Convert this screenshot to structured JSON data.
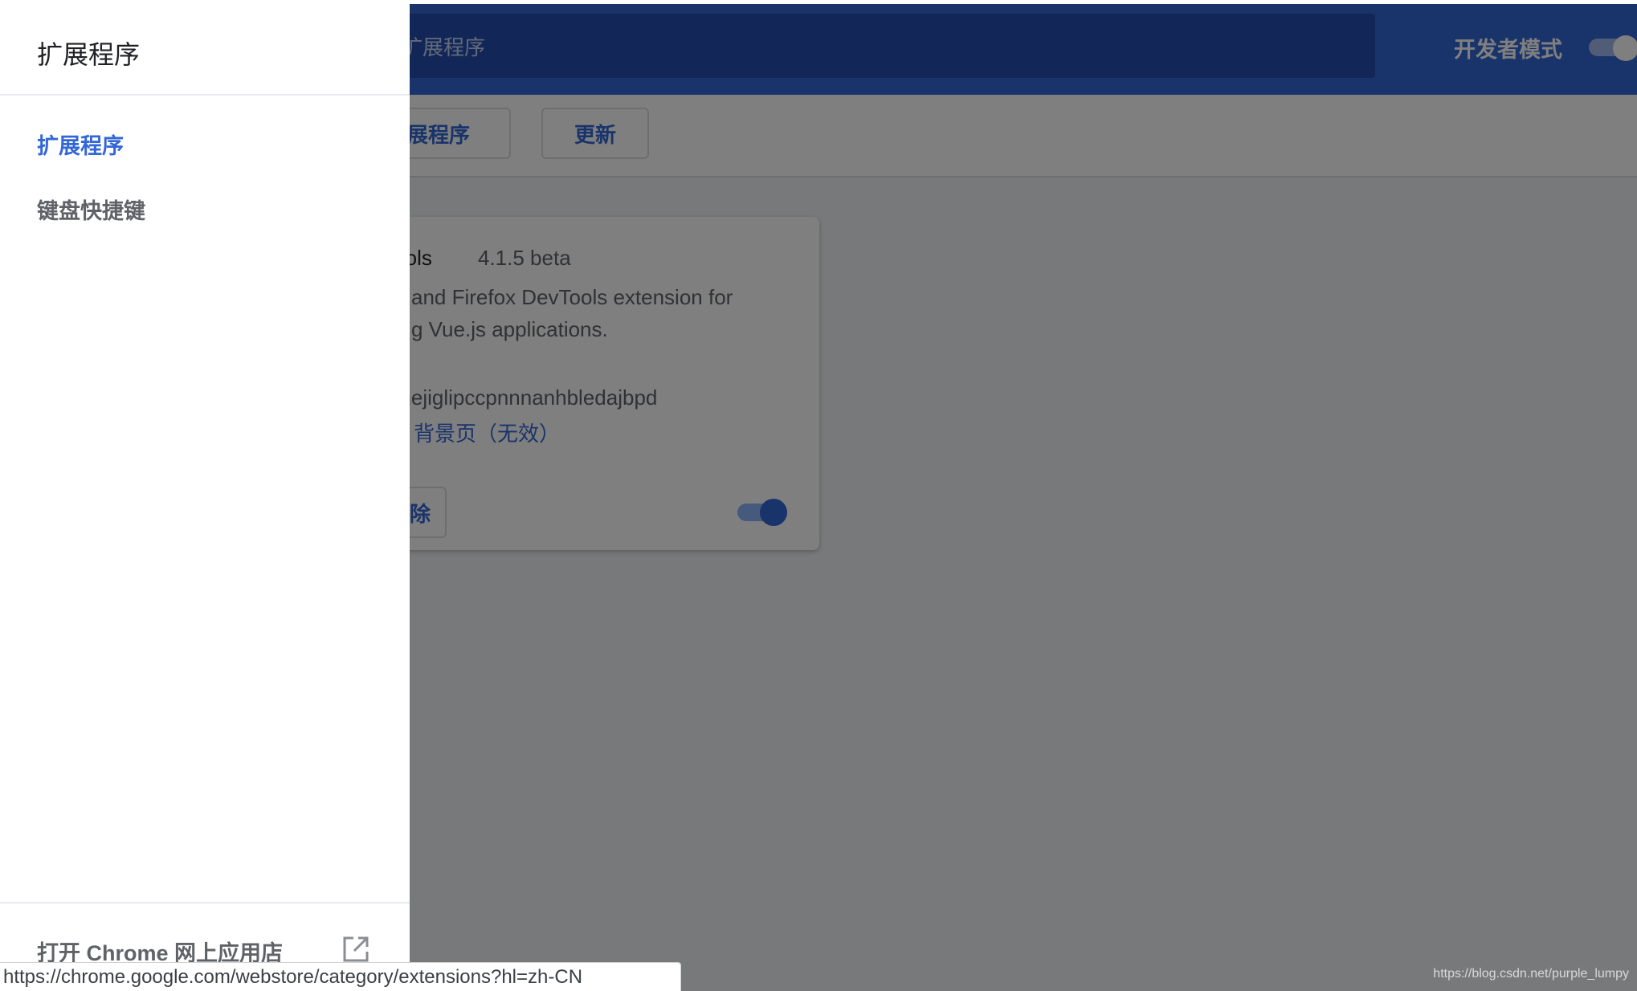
{
  "header": {
    "search_placeholder": "扩展程序",
    "dev_mode_label": "开发者模式"
  },
  "toolbar": {
    "pack_label": "扩展程序",
    "update_label": "更新"
  },
  "extension_card": {
    "name": "vtools",
    "version": "4.1.5 beta",
    "description_line1": "and Firefox DevTools extension for",
    "description_line2": "g Vue.js applications.",
    "id": "gjmejiglipccpnnnanhbledajbpd",
    "views": "背景页（无效）",
    "remove_label": "除",
    "enabled": true
  },
  "drawer": {
    "title": "扩展程序",
    "items": [
      {
        "label": "扩展程序",
        "selected": true
      },
      {
        "label": "键盘快捷键",
        "selected": false
      }
    ],
    "store_link_label": "打开 Chrome 网上应用店",
    "store_icon": "open-in-new-icon"
  },
  "status_bar": {
    "url": "https://chrome.google.com/webstore/category/extensions?hl=zh-CN"
  },
  "watermark": "https://blog.csdn.net/purple_lumpy",
  "colors": {
    "accent": "#3367d6",
    "header_bg": "#3367d6",
    "scrim": "rgba(0,0,0,0.5)"
  }
}
